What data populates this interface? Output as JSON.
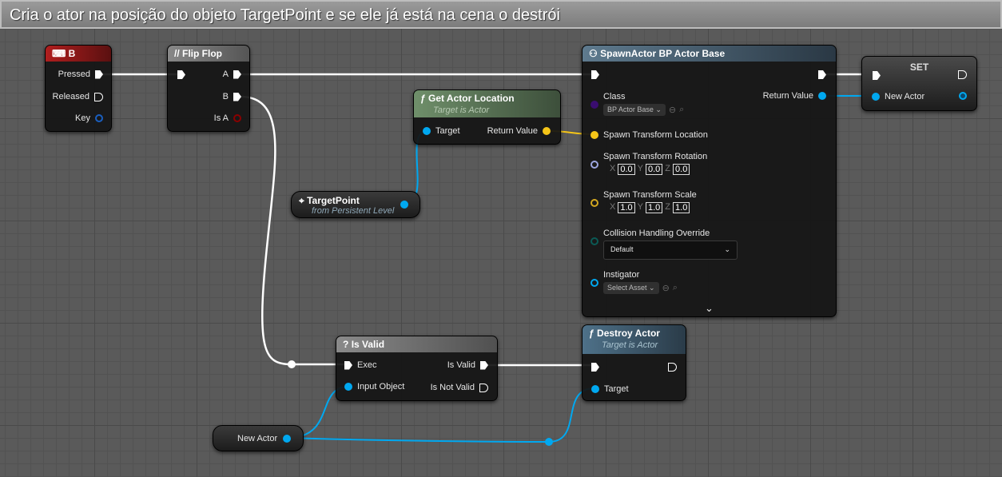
{
  "comment_title": "Cria o ator na posição do objeto TargetPoint e se ele já está na cena o destrói",
  "nodes": {
    "key_b": {
      "title": "B",
      "pins": [
        "Pressed",
        "Released",
        "Key"
      ]
    },
    "flip_flop": {
      "title": "Flip Flop",
      "pins": [
        "A",
        "B",
        "Is A"
      ]
    },
    "get_actor_location": {
      "title": "Get Actor Location",
      "subtitle": "Target is Actor",
      "pins": [
        "Target",
        "Return Value"
      ]
    },
    "target_point": {
      "title": "TargetPoint",
      "subtitle": "from Persistent Level"
    },
    "spawn_actor": {
      "title": "SpawnActor BP Actor Base",
      "class_label": "Class",
      "class_value": "BP Actor Base",
      "return_value": "Return Value",
      "location": "Spawn Transform Location",
      "rotation": "Spawn Transform Rotation",
      "rotation_xyz": [
        "0.0",
        "0.0",
        "0.0"
      ],
      "scale": "Spawn Transform Scale",
      "scale_xyz": [
        "1.0",
        "1.0",
        "1.0"
      ],
      "axes": [
        "X",
        "Y",
        "Z"
      ],
      "collision": "Collision Handling Override",
      "collision_value": "Default",
      "instigator": "Instigator",
      "instigator_value": "Select Asset"
    },
    "set": {
      "title": "SET",
      "pin": "New Actor"
    },
    "is_valid": {
      "title": "Is Valid",
      "pins": [
        "Exec",
        "Input Object",
        "Is Valid",
        "Is Not Valid"
      ]
    },
    "destroy_actor": {
      "title": "Destroy Actor",
      "subtitle": "Target is Actor",
      "pin": "Target"
    },
    "new_actor_get": {
      "title": "New Actor"
    }
  },
  "colors": {
    "exec": "#ffffff",
    "object": "#00a8f0",
    "vector": "#f5c518",
    "rotator": "#9da6e0",
    "class": "#5a1aa0",
    "bool": "#8b0000"
  }
}
